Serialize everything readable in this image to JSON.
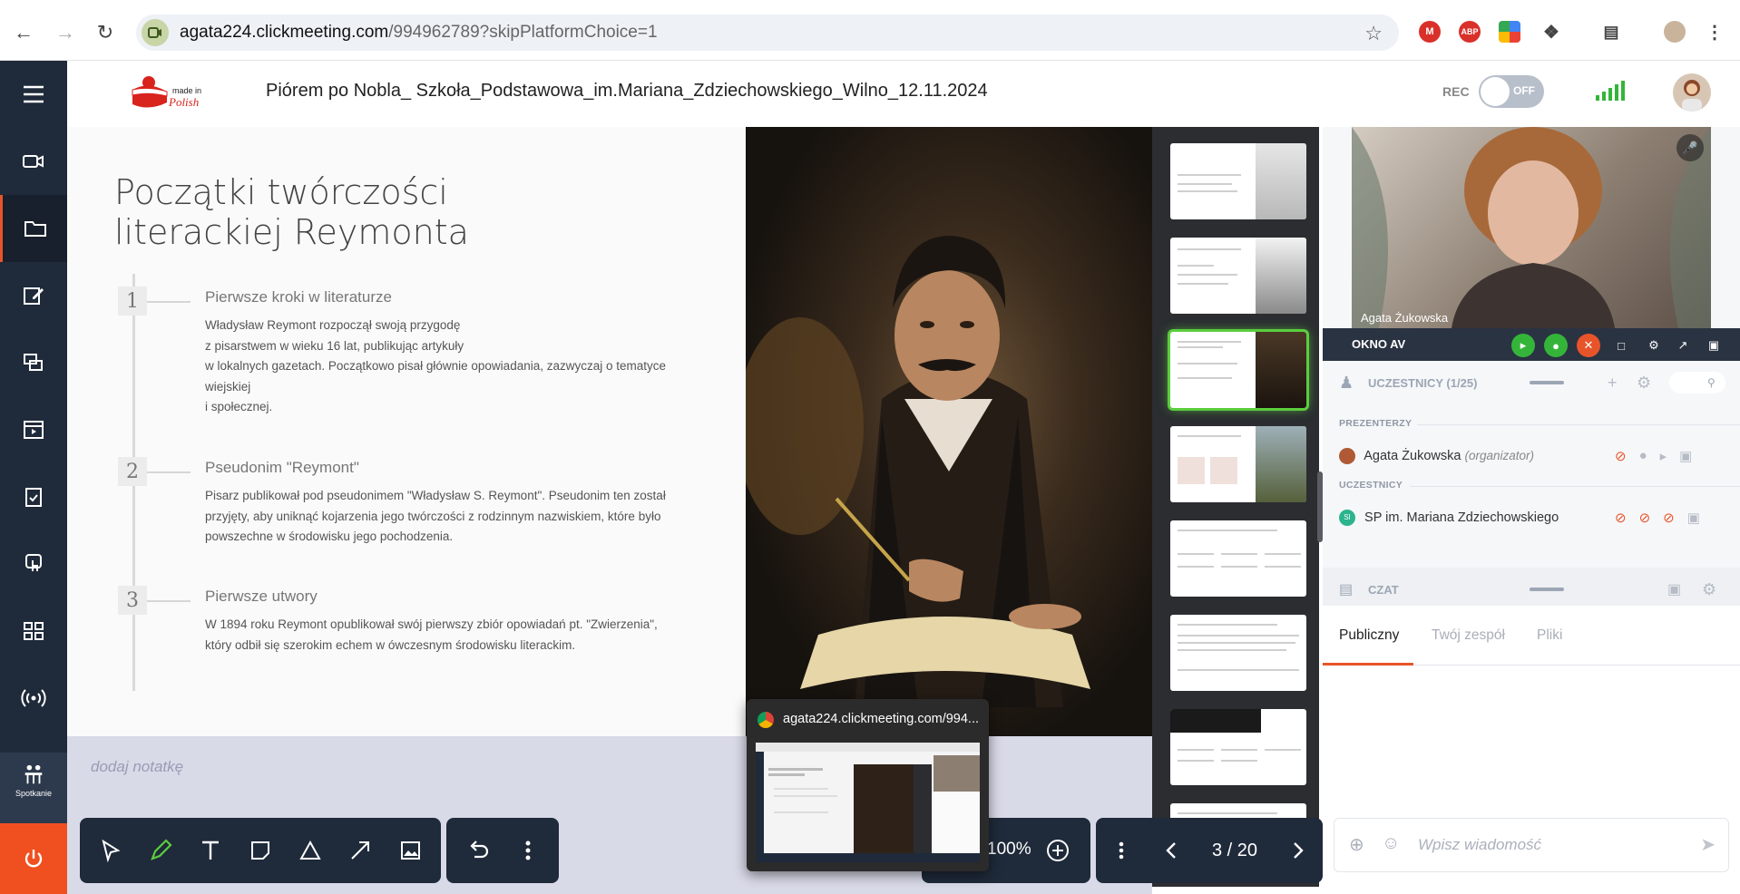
{
  "browser": {
    "url_host": "agata224.clickmeeting.com",
    "url_path": "/994962789?skipPlatformChoice=1",
    "ext_abp_label": "ABP"
  },
  "header": {
    "title": "Piórem po Nobla_ Szkoła_Podstawowa_im.Mariana_Zdziechowskiego_Wilno_12.11.2024",
    "rec_label": "REC",
    "rec_state": "OFF",
    "logo_text": "made in Polish"
  },
  "sidebar": {
    "meeting_label": "Spotkanie"
  },
  "slide": {
    "title": "Początki twórczości literackiej Reymonta",
    "steps": [
      {
        "num": "1",
        "heading": "Pierwsze kroki w literaturze",
        "text": "Władysław Reymont rozpoczął swoją przygodę\nz pisarstwem w wieku 16 lat, publikując artykuły\nw lokalnych gazetach. Początkowo pisał głównie opowiadania, zazwyczaj o tematyce wiejskiej\ni społecznej."
      },
      {
        "num": "2",
        "heading": "Pseudonim \"Reymont\"",
        "text": "Pisarz publikował pod pseudonimem \"Władysław S. Reymont\". Pseudonim ten został przyjęty, aby uniknąć kojarzenia jego twórczości z rodzinnym nazwiskiem, które było powszechne w środowisku jego pochodzenia."
      },
      {
        "num": "3",
        "heading": "Pierwsze utwory",
        "text": "W 1894 roku Reymont opublikował swój pierwszy zbiór opowiadań pt. \"Zwierzenia\", który odbił się szerokim echem w ówczesnym środowisku literackim."
      }
    ]
  },
  "thumbnails": {
    "active_index": 3
  },
  "notes": {
    "placeholder": "dodaj notatkę"
  },
  "toolbar": {
    "zoom": "100%",
    "page": "3 / 20"
  },
  "tab_preview": {
    "title": "agata224.clickmeeting.com/994..."
  },
  "right_panel": {
    "video_name": "Agata Żukowska",
    "av_label": "OKNO AV",
    "participants_title": "UCZESTNICY (1/25)",
    "presenters_label": "PREZENTERZY",
    "attendees_label": "UCZESTNICY",
    "presenter_name": "Agata Żukowska",
    "presenter_role": "(organizator)",
    "attendee_initials": "SI",
    "attendee_name": "SP im. Mariana Zdziechowskiego",
    "chat_title": "CZAT",
    "chat_tabs": [
      "Publiczny",
      "Twój zespół",
      "Pliki"
    ],
    "chat_placeholder": "Wpisz wiadomość"
  },
  "colors": {
    "sidebar": "#1f2a3a",
    "accent": "#e8542a",
    "active_thumb": "#5bcd3e",
    "signal": "#34b53a"
  }
}
